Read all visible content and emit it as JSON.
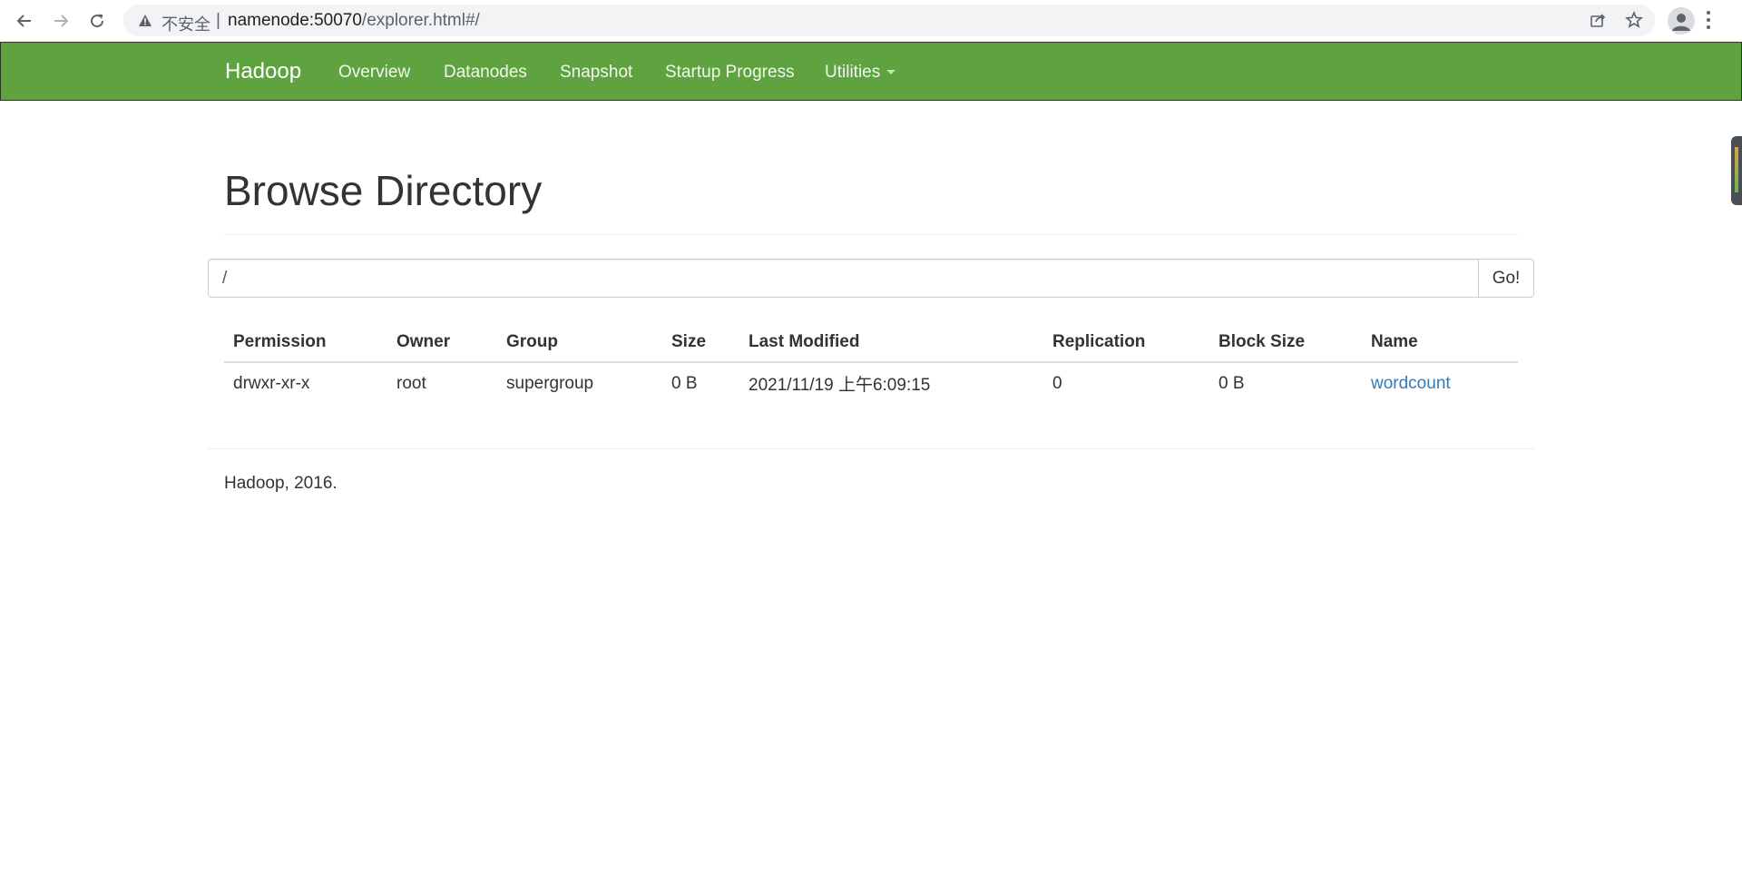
{
  "browser": {
    "insecure_label": "不安全",
    "separator": "|",
    "url_host": "namenode:50070",
    "url_path": "/explorer.html#/"
  },
  "navbar": {
    "brand": "Hadoop",
    "items": [
      {
        "label": "Overview"
      },
      {
        "label": "Datanodes"
      },
      {
        "label": "Snapshot"
      },
      {
        "label": "Startup Progress"
      },
      {
        "label": "Utilities"
      }
    ],
    "color": "#5fa341"
  },
  "page": {
    "title": "Browse Directory",
    "path_value": "/",
    "go_label": "Go!"
  },
  "table": {
    "columns": [
      "Permission",
      "Owner",
      "Group",
      "Size",
      "Last Modified",
      "Replication",
      "Block Size",
      "Name"
    ],
    "rows": [
      {
        "permission": "drwxr-xr-x",
        "owner": "root",
        "group": "supergroup",
        "size": "0 B",
        "last_modified": "2021/11/19 上午6:09:15",
        "replication": "0",
        "block_size": "0 B",
        "name": "wordcount"
      }
    ]
  },
  "footer": {
    "text": "Hadoop, 2016."
  },
  "icons": {
    "back": "arrow-left-icon",
    "forward": "arrow-right-icon",
    "reload": "reload-icon",
    "warning": "warning-triangle-icon",
    "share": "share-icon",
    "bookmark": "star-icon",
    "profile": "person-icon",
    "menu": "kebab-menu-icon"
  },
  "colors": {
    "link": "#337ab7",
    "navbar": "#5fa341"
  }
}
